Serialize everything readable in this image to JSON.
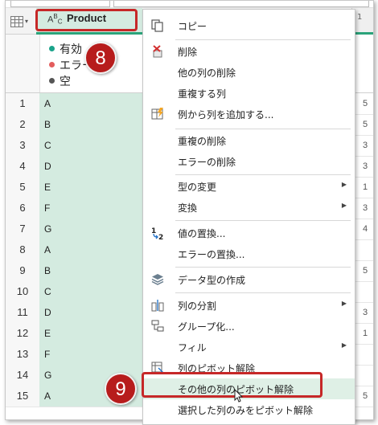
{
  "column": {
    "title": "Product"
  },
  "quality": [
    {
      "label": "有効",
      "color": "#1aa38a"
    },
    {
      "label": "エラー",
      "color": "#e35d5d"
    },
    {
      "label": "空",
      "color": "#555555"
    }
  ],
  "rows": [
    {
      "num": "1",
      "val": "A",
      "right": "5"
    },
    {
      "num": "2",
      "val": "B",
      "right": "5"
    },
    {
      "num": "3",
      "val": "C",
      "right": "3"
    },
    {
      "num": "4",
      "val": "D",
      "right": "3"
    },
    {
      "num": "5",
      "val": "E",
      "right": "1"
    },
    {
      "num": "6",
      "val": "F",
      "right": "3"
    },
    {
      "num": "7",
      "val": "G",
      "right": "4"
    },
    {
      "num": "8",
      "val": "A",
      "right": ""
    },
    {
      "num": "9",
      "val": "B",
      "right": "5"
    },
    {
      "num": "10",
      "val": "C",
      "right": ""
    },
    {
      "num": "11",
      "val": "D",
      "right": "3"
    },
    {
      "num": "12",
      "val": "E",
      "right": "1"
    },
    {
      "num": "13",
      "val": "F",
      "right": ""
    },
    {
      "num": "14",
      "val": "G",
      "right": ""
    },
    {
      "num": "15",
      "val": "A",
      "right": "5"
    }
  ],
  "badges": {
    "step8": "8",
    "step9": "9"
  },
  "menu": {
    "copy": "コピー",
    "remove": "削除",
    "remove_other": "他の列の削除",
    "duplicate": "重複する列",
    "add_from_examples": "例から列を追加する...",
    "remove_duplicates": "重複の削除",
    "remove_errors": "エラーの削除",
    "change_type": "型の変更",
    "transform": "変換",
    "replace_values": "値の置換...",
    "replace_errors": "エラーの置換...",
    "create_data_type": "データ型の作成",
    "split_column": "列の分割",
    "group_by": "グループ化...",
    "fill": "フィル",
    "unpivot": "列のピボット解除",
    "unpivot_other": "その他の列のピボット解除",
    "unpivot_selected": "選択した列のみをピボット解除"
  },
  "colors": {
    "accent": "#2ba37a",
    "selection": "#d4ebe0",
    "highlight_box": "#c62828"
  }
}
